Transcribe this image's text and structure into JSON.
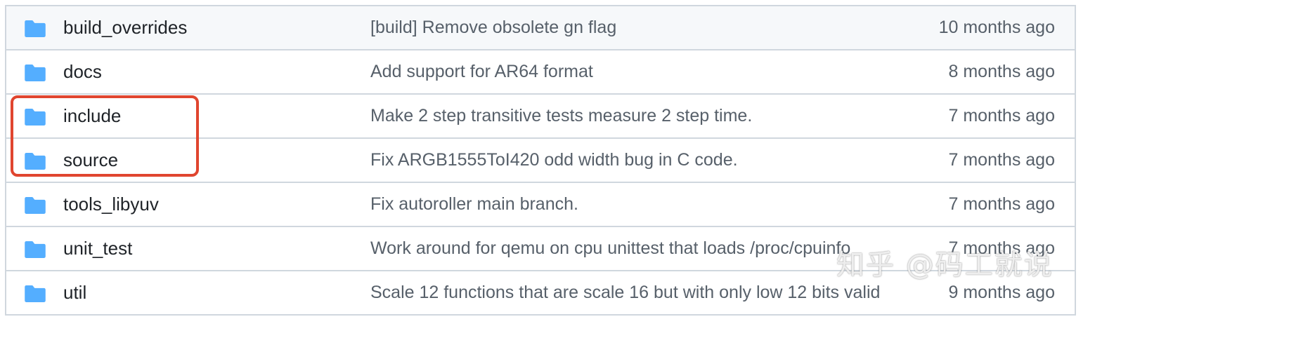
{
  "colors": {
    "folder_icon": "#54aeff",
    "highlight_box": "#e0452f",
    "row_border": "#d0d7de",
    "filename_text": "#1f2328",
    "muted_text": "#57606a"
  },
  "icons": {
    "folder": "folder-icon"
  },
  "rows": [
    {
      "name": "build_overrides",
      "commit": "[build] Remove obsolete gn flag",
      "age": "10 months ago"
    },
    {
      "name": "docs",
      "commit": "Add support for AR64 format",
      "age": "8 months ago"
    },
    {
      "name": "include",
      "commit": "Make 2 step transitive tests measure 2 step time.",
      "age": "7 months ago"
    },
    {
      "name": "source",
      "commit": "Fix ARGB1555ToI420 odd width bug in C code.",
      "age": "7 months ago"
    },
    {
      "name": "tools_libyuv",
      "commit": "Fix autoroller main branch.",
      "age": "7 months ago"
    },
    {
      "name": "unit_test",
      "commit": "Work around for qemu on cpu unittest that loads /proc/cpuinfo",
      "age": "7 months ago"
    },
    {
      "name": "util",
      "commit": "Scale 12 functions that are scale 16 but with only low 12 bits valid",
      "age": "9 months ago"
    }
  ],
  "watermark": {
    "text": "知乎 @码工就说"
  }
}
